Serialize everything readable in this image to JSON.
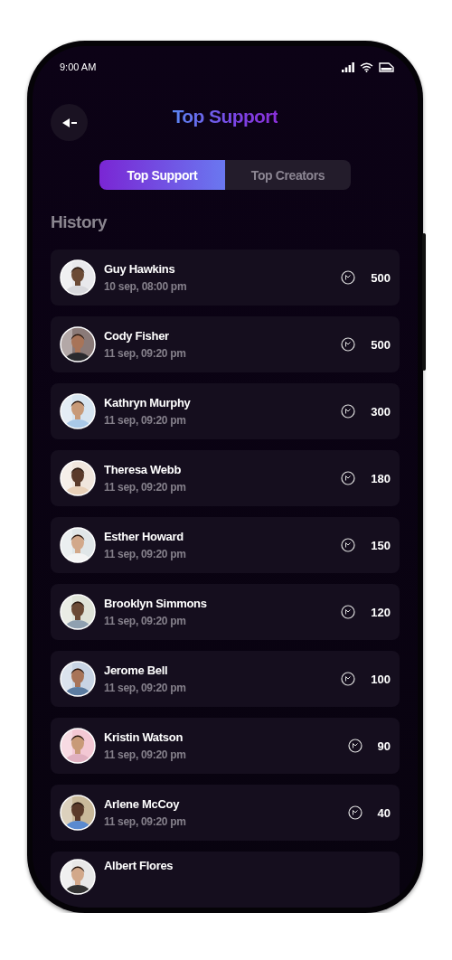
{
  "status_bar": {
    "time": "9:00 AM"
  },
  "header": {
    "title": "Top Support"
  },
  "tabs": [
    {
      "label": "Top Support",
      "selected": true
    },
    {
      "label": "Top Creators",
      "selected": false
    }
  ],
  "section_title": "History",
  "supporters": [
    {
      "name": "Guy Hawkins",
      "time": "10 sep, 08:00 pm",
      "amount": "500"
    },
    {
      "name": "Cody Fisher",
      "time": "11 sep, 09:20 pm",
      "amount": "500"
    },
    {
      "name": "Kathryn Murphy",
      "time": "11 sep, 09:20 pm",
      "amount": "300"
    },
    {
      "name": "Theresa Webb",
      "time": "11 sep, 09:20 pm",
      "amount": "180"
    },
    {
      "name": "Esther Howard",
      "time": "11 sep, 09:20 pm",
      "amount": "150"
    },
    {
      "name": "Brooklyn Simmons",
      "time": "11 sep, 09:20 pm",
      "amount": "120"
    },
    {
      "name": "Jerome Bell",
      "time": "11 sep, 09:20 pm",
      "amount": "100"
    },
    {
      "name": "Kristin Watson",
      "time": "11 sep, 09:20 pm",
      "amount": "90"
    },
    {
      "name": "Arlene McCoy",
      "time": "11 sep, 09:20 pm",
      "amount": "40"
    },
    {
      "name": "Albert Flores"
    }
  ]
}
